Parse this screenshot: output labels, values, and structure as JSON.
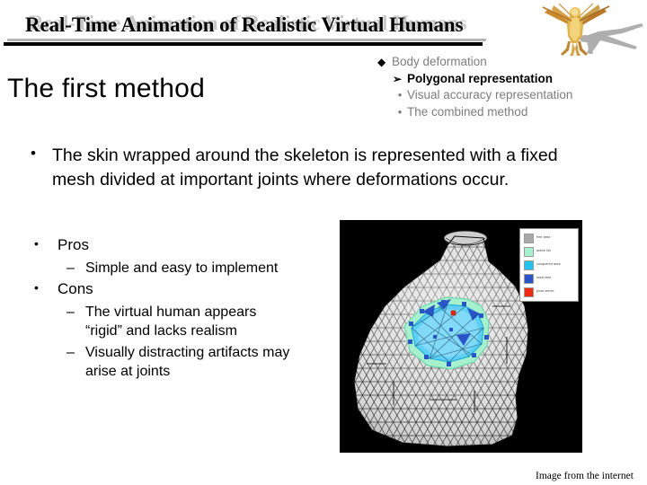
{
  "header": {
    "title": "Real-Time Animation of Realistic Virtual Humans",
    "decor_icon": "vitruvian-man-icon"
  },
  "main_heading": "The first method",
  "outline": {
    "items": [
      {
        "marker": "◆",
        "marker_name": "diamond-bullet-icon",
        "level": 1,
        "label": "Body deformation",
        "active": false
      },
      {
        "marker": "➢",
        "marker_name": "arrow-bullet-icon",
        "level": 2,
        "label": "Polygonal representation",
        "active": true
      },
      {
        "marker": "•",
        "marker_name": "dot-bullet-icon",
        "level": 2,
        "label": "Visual accuracy representation",
        "active": false
      },
      {
        "marker": "•",
        "marker_name": "dot-bullet-icon",
        "level": 2,
        "label": "The combined method",
        "active": false
      }
    ]
  },
  "intro_bullet": {
    "marker": "•",
    "text": "The skin wrapped around the skeleton is represented with a fixed mesh divided at important joints where deformations occur."
  },
  "pros_cons": [
    {
      "marker": "•",
      "label": "Pros",
      "items": [
        {
          "dash": "–",
          "text": "Simple and easy to implement"
        }
      ]
    },
    {
      "marker": "•",
      "label": "Cons",
      "items": [
        {
          "dash": "–",
          "text": "The virtual human appears “rigid” and lacks realism"
        },
        {
          "dash": "–",
          "text": "Visually distracting artifacts may arise at joints"
        }
      ]
    }
  ],
  "mesh_image": {
    "alt_name": "triangular-mesh-shoulder-image",
    "background": "#000000",
    "legend": {
      "items": [
        {
          "color": "#a9a9a9",
          "label": "free area"
        },
        {
          "color": "#a6f0cd",
          "label": "active list"
        },
        {
          "color": "#22c3f0",
          "label": "conquered area"
        },
        {
          "color": "#2a55c8",
          "label": "used face"
        },
        {
          "color": "#f02a10",
          "label": "pivot vertex"
        }
      ]
    }
  },
  "caption": "Image from the internet",
  "colors": {
    "title_black": "#000000",
    "title_shadow_gray": "#c8c8c8",
    "outline_gray": "#7d7d7d",
    "rule_black": "#000000",
    "rule_shadow": "#b5b5b5"
  }
}
